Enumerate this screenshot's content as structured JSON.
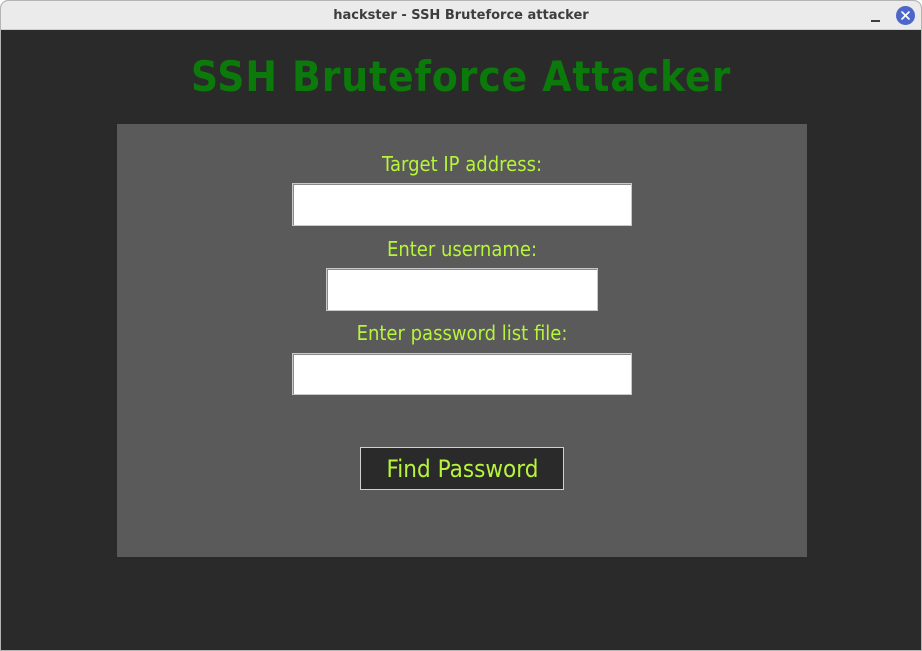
{
  "window": {
    "title": "hackster - SSH Bruteforce attacker"
  },
  "app": {
    "heading": "SSH Bruteforce Attacker",
    "fields": [
      {
        "label": "Target IP address:",
        "value": "",
        "placeholder": ""
      },
      {
        "label": "Enter username:",
        "value": "",
        "placeholder": ""
      },
      {
        "label": "Enter password list file:",
        "value": "",
        "placeholder": ""
      }
    ],
    "button_label": "Find Password"
  },
  "colors": {
    "heading": "#0b7a0b",
    "label": "#b6f53a",
    "background": "#2a2a2a",
    "panel": "#5a5a5a",
    "close_button": "#4d67c9"
  },
  "icons": {
    "minimize": "minimize-icon",
    "close": "close-icon"
  }
}
